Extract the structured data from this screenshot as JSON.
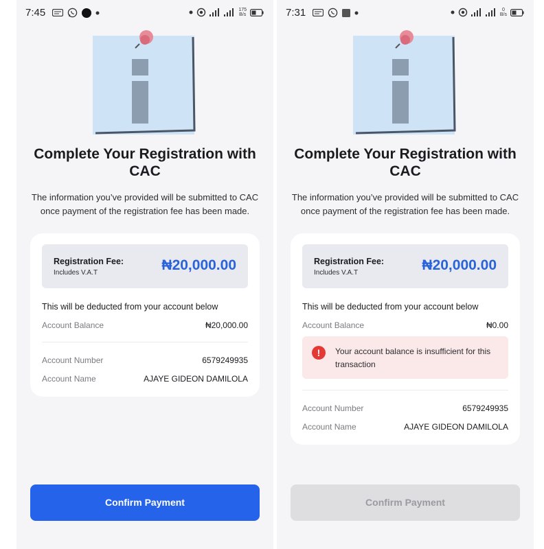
{
  "screens": {
    "a": {
      "status": {
        "time": "7:45",
        "net_speed": "175",
        "net_unit": "B/s"
      },
      "title": "Complete Your Registration with CAC",
      "description": "The information you’ve provided will be submitted to CAC once payment of the registration fee has been made.",
      "fee": {
        "label": "Registration Fee:",
        "sub": "Includes V.A.T",
        "amount": "₦20,000.00"
      },
      "deduct_text": "This will be deducted from your account below",
      "balance": {
        "label": "Account Balance",
        "value": "₦20,000.00"
      },
      "account_number": {
        "label": "Account Number",
        "value": "6579249935"
      },
      "account_name": {
        "label": "Account Name",
        "value": "AJAYE GIDEON DAMILOLA"
      },
      "button": {
        "label": "Confirm Payment",
        "state": "enabled"
      }
    },
    "b": {
      "status": {
        "time": "7:31",
        "net_speed": "0",
        "net_unit": "B/s"
      },
      "title": "Complete Your Registration with CAC",
      "description": "The information you’ve provided will be submitted to CAC once payment of the registration fee has been made.",
      "fee": {
        "label": "Registration Fee:",
        "sub": "Includes V.A.T",
        "amount": "₦20,000.00"
      },
      "deduct_text": "This will be deducted from your account below",
      "balance": {
        "label": "Account Balance",
        "value": "₦0.00"
      },
      "error": {
        "icon": "!",
        "text": "Your account balance is insufficient for this transaction"
      },
      "account_number": {
        "label": "Account Number",
        "value": "6579249935"
      },
      "account_name": {
        "label": "Account Name",
        "value": "AJAYE GIDEON DAMILOLA"
      },
      "button": {
        "label": "Confirm Payment",
        "state": "disabled"
      }
    }
  },
  "colors": {
    "primary": "#2563eb",
    "amount": "#2a63d9",
    "error": "#e53935",
    "error_bg": "#fbe9e9",
    "disabled_bg": "#dedee0"
  },
  "icons": [
    "sms-icon",
    "whatsapp-icon",
    "location-icon",
    "signal-icon",
    "battery-icon",
    "info-note-illustration",
    "error-icon"
  ]
}
